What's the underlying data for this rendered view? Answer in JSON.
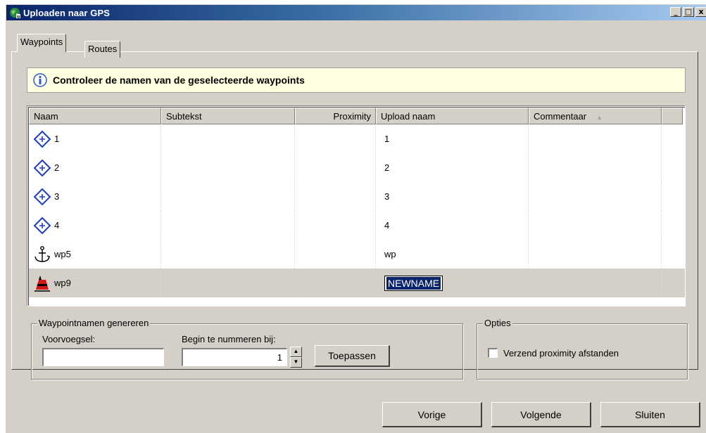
{
  "window": {
    "title": "Uploaden naar GPS"
  },
  "tabs": [
    {
      "label": "Waypoints",
      "active": true
    },
    {
      "label": "Routes",
      "active": false
    }
  ],
  "info": {
    "message": "Controleer de namen van de geselecteerde waypoints"
  },
  "table": {
    "columns": [
      "Naam",
      "Subtekst",
      "Proximity",
      "Upload naam",
      "Commentaar"
    ],
    "sort_column": "Commentaar",
    "rows": [
      {
        "icon": "waypoint-diamond-icon",
        "name": "1",
        "subtext": "",
        "proximity": "",
        "upload_name": "1",
        "comment": ""
      },
      {
        "icon": "waypoint-diamond-icon",
        "name": "2",
        "subtext": "",
        "proximity": "",
        "upload_name": "2",
        "comment": ""
      },
      {
        "icon": "waypoint-diamond-icon",
        "name": "3",
        "subtext": "",
        "proximity": "",
        "upload_name": "3",
        "comment": ""
      },
      {
        "icon": "waypoint-diamond-icon",
        "name": "4",
        "subtext": "",
        "proximity": "",
        "upload_name": "4",
        "comment": ""
      },
      {
        "icon": "anchor-icon",
        "name": "wp5",
        "subtext": "",
        "proximity": "",
        "upload_name": "wp",
        "comment": ""
      },
      {
        "icon": "buoy-icon",
        "name": "wp9",
        "subtext": "",
        "proximity": "",
        "upload_name": "NEWNAME",
        "comment": "",
        "selected": true,
        "editing": true
      }
    ]
  },
  "generate": {
    "legend": "Waypointnamen genereren",
    "prefix_label": "Voorvoegsel:",
    "prefix_value": "",
    "start_label": "Begin te nummeren bij:",
    "start_value": "1",
    "apply_label": "Toepassen"
  },
  "options": {
    "legend": "Opties",
    "send_proximity_label": "Verzend proximity afstanden",
    "send_proximity_checked": false
  },
  "footer": {
    "prev_label": "Vorige",
    "next_label": "Volgende",
    "close_label": "Sluiten"
  },
  "colors": {
    "title_start": "#0a246a",
    "title_end": "#a6caf0",
    "info_bg": "#ffffe1",
    "selection": "#0a246a"
  }
}
